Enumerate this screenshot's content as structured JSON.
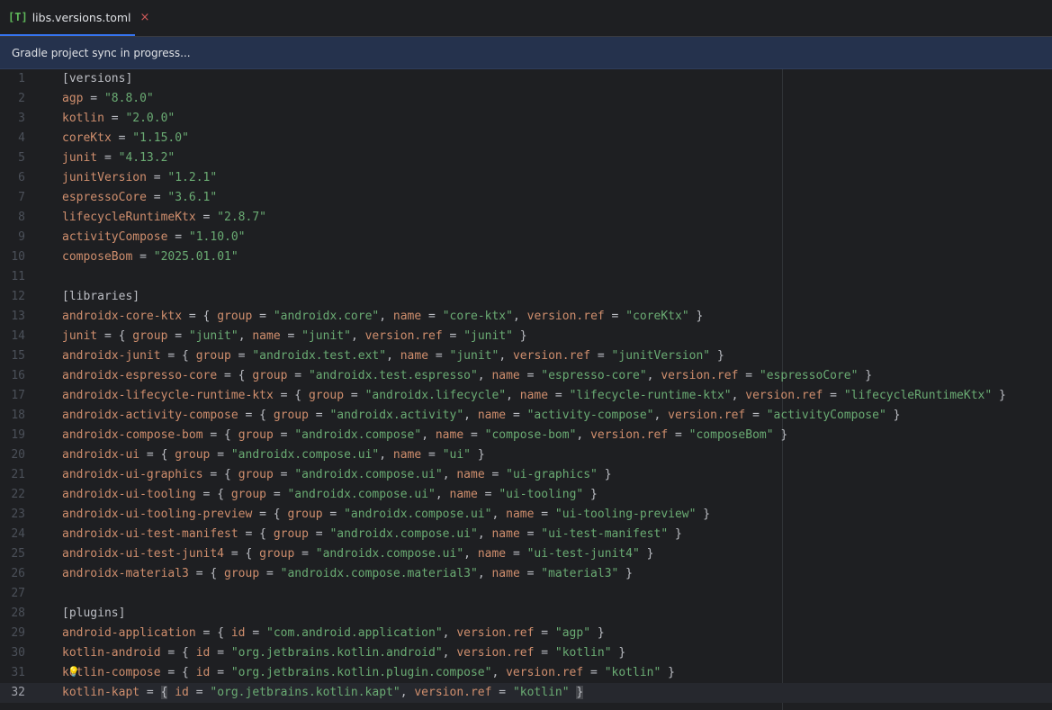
{
  "tab": {
    "icon": "[T]",
    "label": "libs.versions.toml",
    "close": "×"
  },
  "banner": {
    "text": "Gradle project sync in progress..."
  },
  "current_line": 32,
  "lines": [
    [
      {
        "t": "h",
        "v": "[versions]"
      }
    ],
    [
      {
        "t": "k",
        "v": "agp"
      },
      {
        "t": "p",
        "v": " = "
      },
      {
        "t": "s",
        "v": "\"8.8.0\""
      }
    ],
    [
      {
        "t": "k",
        "v": "kotlin"
      },
      {
        "t": "p",
        "v": " = "
      },
      {
        "t": "s",
        "v": "\"2.0.0\""
      }
    ],
    [
      {
        "t": "k",
        "v": "coreKtx"
      },
      {
        "t": "p",
        "v": " = "
      },
      {
        "t": "s",
        "v": "\"1.15.0\""
      }
    ],
    [
      {
        "t": "k",
        "v": "junit"
      },
      {
        "t": "p",
        "v": " = "
      },
      {
        "t": "s",
        "v": "\"4.13.2\""
      }
    ],
    [
      {
        "t": "k",
        "v": "junitVersion"
      },
      {
        "t": "p",
        "v": " = "
      },
      {
        "t": "s",
        "v": "\"1.2.1\""
      }
    ],
    [
      {
        "t": "k",
        "v": "espressoCore"
      },
      {
        "t": "p",
        "v": " = "
      },
      {
        "t": "s",
        "v": "\"3.6.1\""
      }
    ],
    [
      {
        "t": "k",
        "v": "lifecycleRuntimeKtx"
      },
      {
        "t": "p",
        "v": " = "
      },
      {
        "t": "s",
        "v": "\"2.8.7\""
      }
    ],
    [
      {
        "t": "k",
        "v": "activityCompose"
      },
      {
        "t": "p",
        "v": " = "
      },
      {
        "t": "s",
        "v": "\"1.10.0\""
      }
    ],
    [
      {
        "t": "k",
        "v": "composeBom"
      },
      {
        "t": "p",
        "v": " = "
      },
      {
        "t": "s",
        "v": "\"2025.01.01\""
      }
    ],
    [],
    [
      {
        "t": "h",
        "v": "[libraries]"
      }
    ],
    [
      {
        "t": "k",
        "v": "androidx-core-ktx"
      },
      {
        "t": "p",
        "v": " = { "
      },
      {
        "t": "k",
        "v": "group"
      },
      {
        "t": "p",
        "v": " = "
      },
      {
        "t": "s",
        "v": "\"androidx.core\""
      },
      {
        "t": "p",
        "v": ", "
      },
      {
        "t": "k",
        "v": "name"
      },
      {
        "t": "p",
        "v": " = "
      },
      {
        "t": "s",
        "v": "\"core-ktx\""
      },
      {
        "t": "p",
        "v": ", "
      },
      {
        "t": "k",
        "v": "version.ref"
      },
      {
        "t": "p",
        "v": " = "
      },
      {
        "t": "s",
        "v": "\"coreKtx\""
      },
      {
        "t": "p",
        "v": " }"
      }
    ],
    [
      {
        "t": "k",
        "v": "junit"
      },
      {
        "t": "p",
        "v": " = { "
      },
      {
        "t": "k",
        "v": "group"
      },
      {
        "t": "p",
        "v": " = "
      },
      {
        "t": "s",
        "v": "\"junit\""
      },
      {
        "t": "p",
        "v": ", "
      },
      {
        "t": "k",
        "v": "name"
      },
      {
        "t": "p",
        "v": " = "
      },
      {
        "t": "s",
        "v": "\"junit\""
      },
      {
        "t": "p",
        "v": ", "
      },
      {
        "t": "k",
        "v": "version.ref"
      },
      {
        "t": "p",
        "v": " = "
      },
      {
        "t": "s",
        "v": "\"junit\""
      },
      {
        "t": "p",
        "v": " }"
      }
    ],
    [
      {
        "t": "k",
        "v": "androidx-junit"
      },
      {
        "t": "p",
        "v": " = { "
      },
      {
        "t": "k",
        "v": "group"
      },
      {
        "t": "p",
        "v": " = "
      },
      {
        "t": "s",
        "v": "\"androidx.test.ext\""
      },
      {
        "t": "p",
        "v": ", "
      },
      {
        "t": "k",
        "v": "name"
      },
      {
        "t": "p",
        "v": " = "
      },
      {
        "t": "s",
        "v": "\"junit\""
      },
      {
        "t": "p",
        "v": ", "
      },
      {
        "t": "k",
        "v": "version.ref"
      },
      {
        "t": "p",
        "v": " = "
      },
      {
        "t": "s",
        "v": "\"junitVersion\""
      },
      {
        "t": "p",
        "v": " }"
      }
    ],
    [
      {
        "t": "k",
        "v": "androidx-espresso-core"
      },
      {
        "t": "p",
        "v": " = { "
      },
      {
        "t": "k",
        "v": "group"
      },
      {
        "t": "p",
        "v": " = "
      },
      {
        "t": "s",
        "v": "\"androidx.test.espresso\""
      },
      {
        "t": "p",
        "v": ", "
      },
      {
        "t": "k",
        "v": "name"
      },
      {
        "t": "p",
        "v": " = "
      },
      {
        "t": "s",
        "v": "\"espresso-core\""
      },
      {
        "t": "p",
        "v": ", "
      },
      {
        "t": "k",
        "v": "version.ref"
      },
      {
        "t": "p",
        "v": " = "
      },
      {
        "t": "s",
        "v": "\"espressoCore\""
      },
      {
        "t": "p",
        "v": " }"
      }
    ],
    [
      {
        "t": "k",
        "v": "androidx-lifecycle-runtime-ktx"
      },
      {
        "t": "p",
        "v": " = { "
      },
      {
        "t": "k",
        "v": "group"
      },
      {
        "t": "p",
        "v": " = "
      },
      {
        "t": "s",
        "v": "\"androidx.lifecycle\""
      },
      {
        "t": "p",
        "v": ", "
      },
      {
        "t": "k",
        "v": "name"
      },
      {
        "t": "p",
        "v": " = "
      },
      {
        "t": "s",
        "v": "\"lifecycle-runtime-ktx\""
      },
      {
        "t": "p",
        "v": ", "
      },
      {
        "t": "k",
        "v": "version.ref"
      },
      {
        "t": "p",
        "v": " = "
      },
      {
        "t": "s",
        "v": "\"lifecycleRuntimeKtx\""
      },
      {
        "t": "p",
        "v": " }"
      }
    ],
    [
      {
        "t": "k",
        "v": "androidx-activity-compose"
      },
      {
        "t": "p",
        "v": " = { "
      },
      {
        "t": "k",
        "v": "group"
      },
      {
        "t": "p",
        "v": " = "
      },
      {
        "t": "s",
        "v": "\"androidx.activity\""
      },
      {
        "t": "p",
        "v": ", "
      },
      {
        "t": "k",
        "v": "name"
      },
      {
        "t": "p",
        "v": " = "
      },
      {
        "t": "s",
        "v": "\"activity-compose\""
      },
      {
        "t": "p",
        "v": ", "
      },
      {
        "t": "k",
        "v": "version.ref"
      },
      {
        "t": "p",
        "v": " = "
      },
      {
        "t": "s",
        "v": "\"activityCompose\""
      },
      {
        "t": "p",
        "v": " }"
      }
    ],
    [
      {
        "t": "k",
        "v": "androidx-compose-bom"
      },
      {
        "t": "p",
        "v": " = { "
      },
      {
        "t": "k",
        "v": "group"
      },
      {
        "t": "p",
        "v": " = "
      },
      {
        "t": "s",
        "v": "\"androidx.compose\""
      },
      {
        "t": "p",
        "v": ", "
      },
      {
        "t": "k",
        "v": "name"
      },
      {
        "t": "p",
        "v": " = "
      },
      {
        "t": "s",
        "v": "\"compose-bom\""
      },
      {
        "t": "p",
        "v": ", "
      },
      {
        "t": "k",
        "v": "version.ref"
      },
      {
        "t": "p",
        "v": " = "
      },
      {
        "t": "s",
        "v": "\"composeBom\""
      },
      {
        "t": "p",
        "v": " }"
      }
    ],
    [
      {
        "t": "k",
        "v": "androidx-ui"
      },
      {
        "t": "p",
        "v": " = { "
      },
      {
        "t": "k",
        "v": "group"
      },
      {
        "t": "p",
        "v": " = "
      },
      {
        "t": "s",
        "v": "\"androidx.compose.ui\""
      },
      {
        "t": "p",
        "v": ", "
      },
      {
        "t": "k",
        "v": "name"
      },
      {
        "t": "p",
        "v": " = "
      },
      {
        "t": "s",
        "v": "\"ui\""
      },
      {
        "t": "p",
        "v": " }"
      }
    ],
    [
      {
        "t": "k",
        "v": "androidx-ui-graphics"
      },
      {
        "t": "p",
        "v": " = { "
      },
      {
        "t": "k",
        "v": "group"
      },
      {
        "t": "p",
        "v": " = "
      },
      {
        "t": "s",
        "v": "\"androidx.compose.ui\""
      },
      {
        "t": "p",
        "v": ", "
      },
      {
        "t": "k",
        "v": "name"
      },
      {
        "t": "p",
        "v": " = "
      },
      {
        "t": "s",
        "v": "\"ui-graphics\""
      },
      {
        "t": "p",
        "v": " }"
      }
    ],
    [
      {
        "t": "k",
        "v": "androidx-ui-tooling"
      },
      {
        "t": "p",
        "v": " = { "
      },
      {
        "t": "k",
        "v": "group"
      },
      {
        "t": "p",
        "v": " = "
      },
      {
        "t": "s",
        "v": "\"androidx.compose.ui\""
      },
      {
        "t": "p",
        "v": ", "
      },
      {
        "t": "k",
        "v": "name"
      },
      {
        "t": "p",
        "v": " = "
      },
      {
        "t": "s",
        "v": "\"ui-tooling\""
      },
      {
        "t": "p",
        "v": " }"
      }
    ],
    [
      {
        "t": "k",
        "v": "androidx-ui-tooling-preview"
      },
      {
        "t": "p",
        "v": " = { "
      },
      {
        "t": "k",
        "v": "group"
      },
      {
        "t": "p",
        "v": " = "
      },
      {
        "t": "s",
        "v": "\"androidx.compose.ui\""
      },
      {
        "t": "p",
        "v": ", "
      },
      {
        "t": "k",
        "v": "name"
      },
      {
        "t": "p",
        "v": " = "
      },
      {
        "t": "s",
        "v": "\"ui-tooling-preview\""
      },
      {
        "t": "p",
        "v": " }"
      }
    ],
    [
      {
        "t": "k",
        "v": "androidx-ui-test-manifest"
      },
      {
        "t": "p",
        "v": " = { "
      },
      {
        "t": "k",
        "v": "group"
      },
      {
        "t": "p",
        "v": " = "
      },
      {
        "t": "s",
        "v": "\"androidx.compose.ui\""
      },
      {
        "t": "p",
        "v": ", "
      },
      {
        "t": "k",
        "v": "name"
      },
      {
        "t": "p",
        "v": " = "
      },
      {
        "t": "s",
        "v": "\"ui-test-manifest\""
      },
      {
        "t": "p",
        "v": " }"
      }
    ],
    [
      {
        "t": "k",
        "v": "androidx-ui-test-junit4"
      },
      {
        "t": "p",
        "v": " = { "
      },
      {
        "t": "k",
        "v": "group"
      },
      {
        "t": "p",
        "v": " = "
      },
      {
        "t": "s",
        "v": "\"androidx.compose.ui\""
      },
      {
        "t": "p",
        "v": ", "
      },
      {
        "t": "k",
        "v": "name"
      },
      {
        "t": "p",
        "v": " = "
      },
      {
        "t": "s",
        "v": "\"ui-test-junit4\""
      },
      {
        "t": "p",
        "v": " }"
      }
    ],
    [
      {
        "t": "k",
        "v": "androidx-material3"
      },
      {
        "t": "p",
        "v": " = { "
      },
      {
        "t": "k",
        "v": "group"
      },
      {
        "t": "p",
        "v": " = "
      },
      {
        "t": "s",
        "v": "\"androidx.compose.material3\""
      },
      {
        "t": "p",
        "v": ", "
      },
      {
        "t": "k",
        "v": "name"
      },
      {
        "t": "p",
        "v": " = "
      },
      {
        "t": "s",
        "v": "\"material3\""
      },
      {
        "t": "p",
        "v": " }"
      }
    ],
    [],
    [
      {
        "t": "h",
        "v": "[plugins]"
      }
    ],
    [
      {
        "t": "k",
        "v": "android-application"
      },
      {
        "t": "p",
        "v": " = { "
      },
      {
        "t": "k",
        "v": "id"
      },
      {
        "t": "p",
        "v": " = "
      },
      {
        "t": "s",
        "v": "\"com.android.application\""
      },
      {
        "t": "p",
        "v": ", "
      },
      {
        "t": "k",
        "v": "version.ref"
      },
      {
        "t": "p",
        "v": " = "
      },
      {
        "t": "s",
        "v": "\"agp\""
      },
      {
        "t": "p",
        "v": " }"
      }
    ],
    [
      {
        "t": "k",
        "v": "kotlin-android"
      },
      {
        "t": "p",
        "v": " = { "
      },
      {
        "t": "k",
        "v": "id"
      },
      {
        "t": "p",
        "v": " = "
      },
      {
        "t": "s",
        "v": "\"org.jetbrains.kotlin.android\""
      },
      {
        "t": "p",
        "v": ", "
      },
      {
        "t": "k",
        "v": "version.ref"
      },
      {
        "t": "p",
        "v": " = "
      },
      {
        "t": "s",
        "v": "\"kotlin\""
      },
      {
        "t": "p",
        "v": " }"
      }
    ],
    [
      {
        "t": "k",
        "v": "kotlin-compose"
      },
      {
        "t": "p",
        "v": " = { "
      },
      {
        "t": "k",
        "v": "id"
      },
      {
        "t": "p",
        "v": " = "
      },
      {
        "t": "s",
        "v": "\"org.jetbrains.kotlin.plugin.compose\""
      },
      {
        "t": "p",
        "v": ", "
      },
      {
        "t": "k",
        "v": "version.ref"
      },
      {
        "t": "p",
        "v": " = "
      },
      {
        "t": "s",
        "v": "\"kotlin\""
      },
      {
        "t": "p",
        "v": " }"
      }
    ],
    [
      {
        "t": "k",
        "v": "kotlin-kapt"
      },
      {
        "t": "p",
        "v": " = "
      },
      {
        "t": "b",
        "v": "{"
      },
      {
        "t": "p",
        "v": " "
      },
      {
        "t": "k",
        "v": "id"
      },
      {
        "t": "p",
        "v": " = "
      },
      {
        "t": "s",
        "v": "\"org.jetbrains.kotlin.kapt\""
      },
      {
        "t": "p",
        "v": ", "
      },
      {
        "t": "k",
        "v": "version.ref"
      },
      {
        "t": "p",
        "v": " = "
      },
      {
        "t": "s",
        "v": "\"kotlin\""
      },
      {
        "t": "p",
        "v": " "
      },
      {
        "t": "b",
        "v": "}"
      }
    ]
  ],
  "colors": {
    "accent": "#3574f0",
    "key": "#cf8e6d",
    "string": "#6aab73",
    "banner_bg": "#25324d"
  },
  "icons": {
    "tab": "toml-file-icon",
    "close": "close-icon",
    "intention": "lightbulb-icon"
  }
}
